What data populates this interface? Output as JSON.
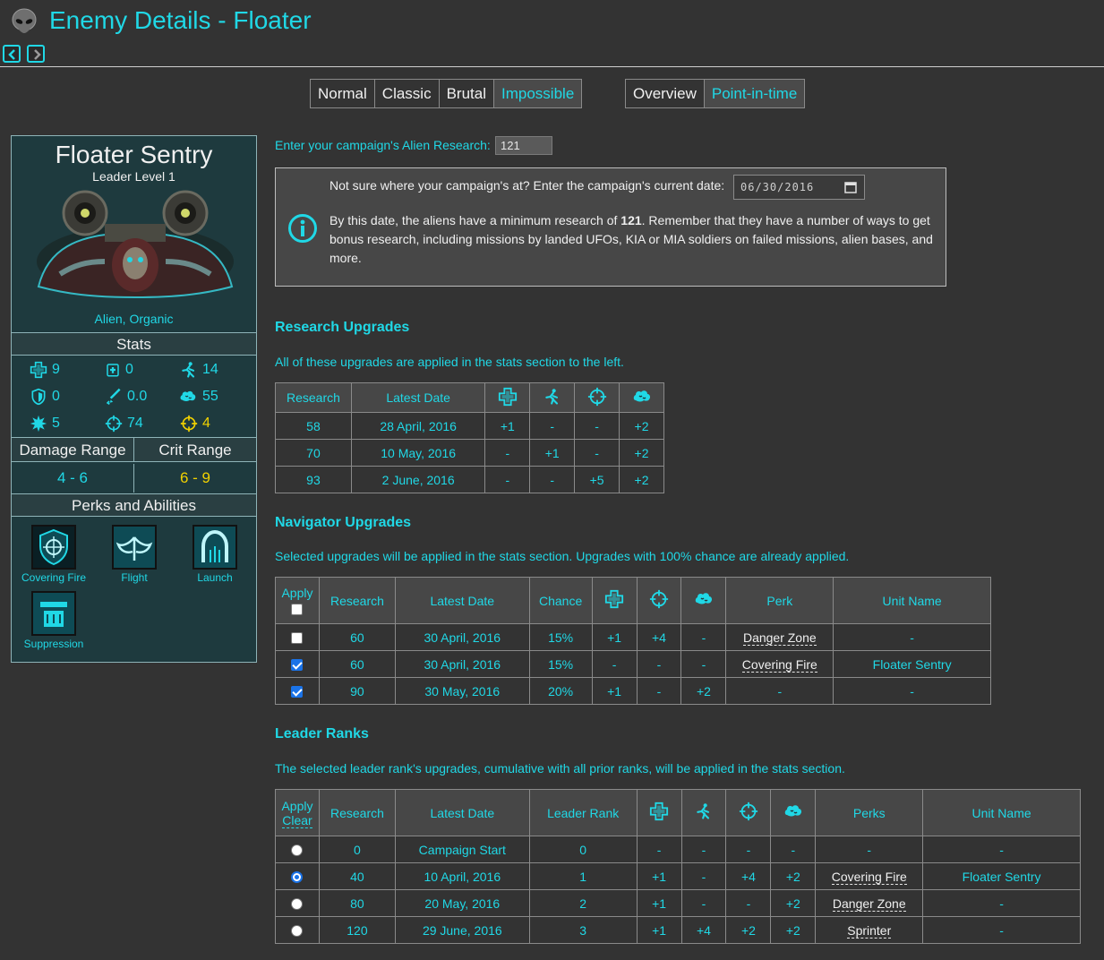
{
  "header": {
    "title": "Enemy Details - Floater"
  },
  "difficulty_tabs": [
    {
      "label": "Normal",
      "active": false
    },
    {
      "label": "Classic",
      "active": false
    },
    {
      "label": "Brutal",
      "active": false
    },
    {
      "label": "Impossible",
      "active": true
    }
  ],
  "view_tabs": [
    {
      "label": "Overview",
      "active": false
    },
    {
      "label": "Point-in-time",
      "active": true
    }
  ],
  "unit": {
    "name": "Floater Sentry",
    "level": "Leader Level 1",
    "type": "Alien, Organic",
    "stats_heading": "Stats",
    "stats": {
      "health": "9",
      "armor": "0",
      "mobility": "14",
      "defense": "0",
      "damage_reduction": "0.0",
      "will": "55",
      "critical": "5",
      "aim": "74",
      "crit_aim": "4"
    },
    "damage_range_label": "Damage Range",
    "crit_range_label": "Crit Range",
    "damage_range": "4 - 6",
    "crit_range": "6 - 9",
    "perks_heading": "Perks and Abilities",
    "perks": [
      "Covering Fire",
      "Flight",
      "Launch",
      "Suppression"
    ]
  },
  "research": {
    "label": "Enter your campaign's Alien Research:",
    "value": "121",
    "date_prompt": "Not sure where your campaign's at? Enter the campaign's current date:",
    "date_value": "06/30/2016",
    "info_pre": "By this date, the aliens have a minimum research of ",
    "info_bold": "121",
    "info_post_line1": ". Remember that they have a number of ways to get",
    "info_line2": "bonus research, including missions by landed UFOs, KIA or MIA soldiers on failed missions, alien bases, and",
    "info_line3": "more."
  },
  "research_upgrades": {
    "title": "Research Upgrades",
    "note": "All of these upgrades are applied in the stats section to the left.",
    "headers": [
      "Research",
      "Latest Date"
    ],
    "rows": [
      [
        "58",
        "28 April, 2016",
        "+1",
        "-",
        "-",
        "+2"
      ],
      [
        "70",
        "10 May, 2016",
        "-",
        "+1",
        "-",
        "+2"
      ],
      [
        "93",
        "2 June, 2016",
        "-",
        "-",
        "+5",
        "+2"
      ]
    ]
  },
  "navigator_upgrades": {
    "title": "Navigator Upgrades",
    "note": "Selected upgrades will be applied in the stats section. Upgrades with 100% chance are already applied.",
    "headers": [
      "Apply",
      "Research",
      "Latest Date",
      "Chance",
      "Perk",
      "Unit Name"
    ],
    "rows": [
      {
        "checked": false,
        "cells": [
          "60",
          "30 April, 2016",
          "15%",
          "+1",
          "+4",
          "-"
        ],
        "perk": "Danger Zone",
        "unit": "-"
      },
      {
        "checked": true,
        "cells": [
          "60",
          "30 April, 2016",
          "15%",
          "-",
          "-",
          "-"
        ],
        "perk": "Covering Fire",
        "unit": "Floater Sentry"
      },
      {
        "checked": true,
        "cells": [
          "90",
          "30 May, 2016",
          "20%",
          "+1",
          "-",
          "+2"
        ],
        "perk": "-",
        "unit": "-"
      }
    ]
  },
  "leader_ranks": {
    "title": "Leader Ranks",
    "note": "The selected leader rank's upgrades, cumulative with all prior ranks, will be applied in the stats section.",
    "headers": [
      "Apply",
      "Clear",
      "Research",
      "Latest Date",
      "Leader Rank",
      "Perks",
      "Unit Name"
    ],
    "rows": [
      {
        "selected": false,
        "cells": [
          "0",
          "Campaign Start",
          "0",
          "-",
          "-",
          "-",
          "-"
        ],
        "perk": "-",
        "unit": "-"
      },
      {
        "selected": true,
        "cells": [
          "40",
          "10 April, 2016",
          "1",
          "+1",
          "-",
          "+4",
          "+2"
        ],
        "perk": "Covering Fire",
        "unit": "Floater Sentry"
      },
      {
        "selected": false,
        "cells": [
          "80",
          "20 May, 2016",
          "2",
          "+1",
          "-",
          "-",
          "+2"
        ],
        "perk": "Danger Zone",
        "unit": "-"
      },
      {
        "selected": false,
        "cells": [
          "120",
          "29 June, 2016",
          "3",
          "+1",
          "+4",
          "+2",
          "+2"
        ],
        "perk": "Sprinter",
        "unit": "-"
      }
    ]
  },
  "colors": {
    "accent": "#20d8e6",
    "crit": "#f2d200",
    "background": "#333333",
    "panel": "#1e3a3e"
  }
}
